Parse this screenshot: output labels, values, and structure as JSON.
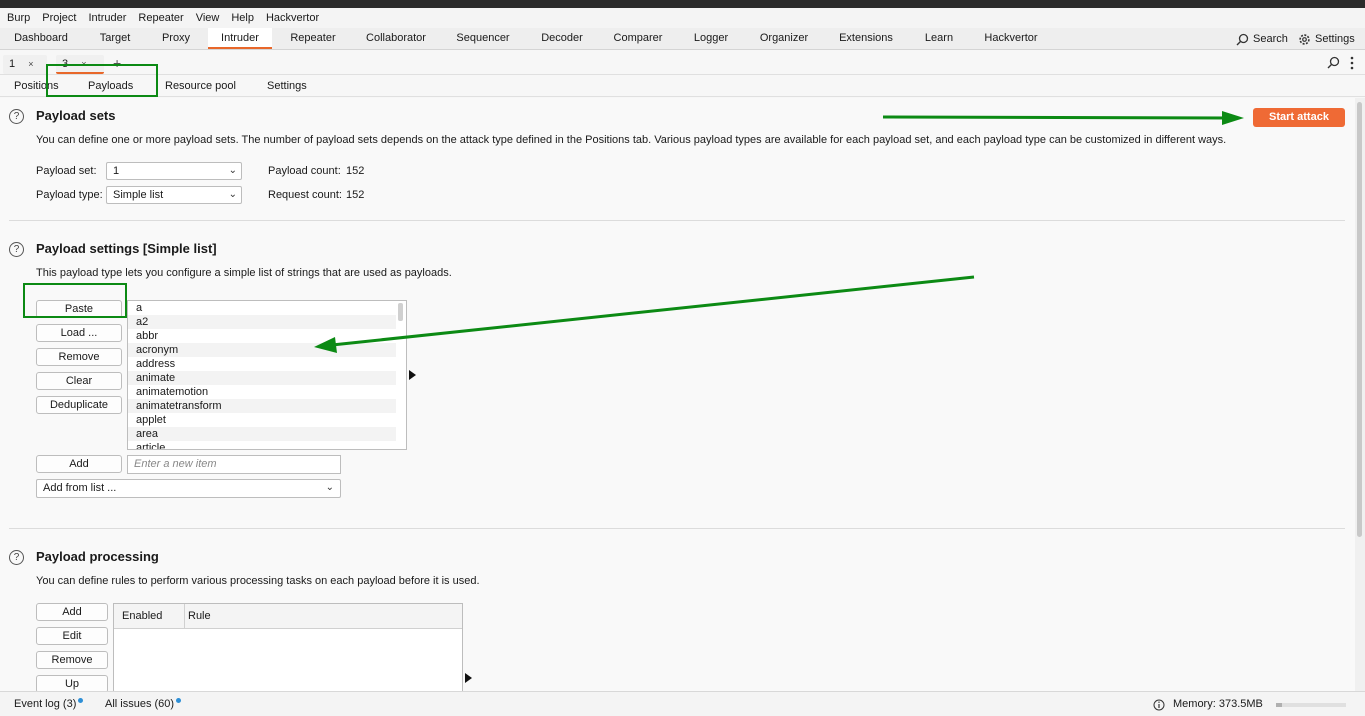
{
  "menu": [
    "Burp",
    "Project",
    "Intruder",
    "Repeater",
    "View",
    "Help",
    "Hackvertor"
  ],
  "main_tabs": [
    "Dashboard",
    "Target",
    "Proxy",
    "Intruder",
    "Repeater",
    "Collaborator",
    "Sequencer",
    "Decoder",
    "Comparer",
    "Logger",
    "Organizer",
    "Extensions",
    "Learn",
    "Hackvertor"
  ],
  "active_main_tab": "Intruder",
  "top_right": {
    "search": "Search",
    "settings": "Settings"
  },
  "attack_tabs": [
    {
      "label": "1",
      "close": "×"
    },
    {
      "label": "3",
      "close": "×"
    }
  ],
  "add_tab": "+",
  "inner_tabs": [
    "Positions",
    "Payloads",
    "Resource pool",
    "Settings"
  ],
  "payload_sets": {
    "help": "?",
    "title": "Payload sets",
    "description": "You can define one or more payload sets. The number of payload sets depends on the attack type defined in the Positions tab. Various payload types are available for each payload set, and each payload type can be customized in different ways.",
    "set_label": "Payload set:",
    "set_value": "1",
    "type_label": "Payload type:",
    "type_value": "Simple list",
    "payload_count_label": "Payload count:",
    "payload_count": "152",
    "request_count_label": "Request count:",
    "request_count": "152",
    "start_attack": "Start attack"
  },
  "payload_settings": {
    "help": "?",
    "title": "Payload settings [Simple list]",
    "description": "This payload type lets you configure a simple list of strings that are used as payloads.",
    "buttons": [
      "Paste",
      "Load ...",
      "Remove",
      "Clear",
      "Deduplicate"
    ],
    "items": [
      "a",
      "a2",
      "abbr",
      "acronym",
      "address",
      "animate",
      "animatemotion",
      "animatetransform",
      "applet",
      "area",
      "article"
    ],
    "add_button": "Add",
    "new_item_placeholder": "Enter a new item",
    "add_from_list": "Add from list ..."
  },
  "payload_processing": {
    "help": "?",
    "title": "Payload processing",
    "description": "You can define rules to perform various processing tasks on each payload before it is used.",
    "buttons": [
      "Add",
      "Edit",
      "Remove",
      "Up"
    ],
    "columns": [
      "Enabled",
      "Rule"
    ]
  },
  "status": {
    "event_log": "Event log (3)",
    "all_issues": "All issues (60)",
    "memory": "Memory: 373.5MB",
    "memory_usage_fraction": 0.08
  },
  "colors": {
    "accent": "#e8672a",
    "start_attack_bg": "#ef6a35",
    "annotation_green": "#0c8a14",
    "notification_dot": "#2e8fd6"
  }
}
